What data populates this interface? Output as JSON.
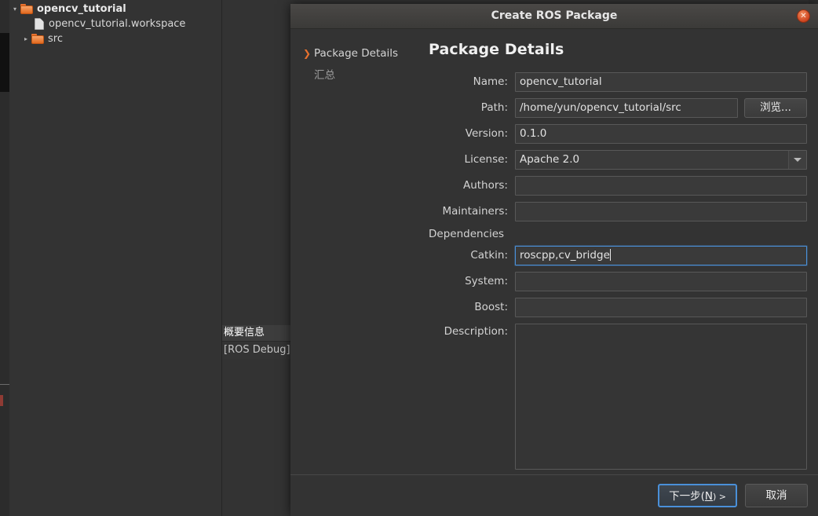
{
  "ide": {
    "tree": [
      {
        "twisty": "▾",
        "indent": 0,
        "icon": "folder-icon",
        "label": "opencv_tutorial",
        "bold": true
      },
      {
        "twisty": "",
        "indent": 1,
        "icon": "file-icon",
        "label": "opencv_tutorial.workspace",
        "bold": false
      },
      {
        "twisty": "▸",
        "indent": 1,
        "icon": "folder-icon",
        "label": "src",
        "bold": false
      }
    ],
    "summary_popup": {
      "header": "概要信息",
      "body": "[ROS Debug]"
    }
  },
  "dialog": {
    "title": "Create ROS Package",
    "close_label": "✕",
    "nav": [
      {
        "label": "Package Details",
        "arrow": "❯",
        "active": true
      },
      {
        "label": "汇总",
        "arrow": "❯",
        "active": false
      }
    ],
    "heading": "Package Details",
    "fields": {
      "name_label": "Name:",
      "name_value": "opencv_tutorial",
      "path_label": "Path:",
      "path_value": "/home/yun/opencv_tutorial/src",
      "browse_label": "浏览...",
      "version_label": "Version:",
      "version_value": "0.1.0",
      "license_label": "License:",
      "license_value": "Apache 2.0",
      "authors_label": "Authors:",
      "authors_value": "",
      "maintainers_label": "Maintainers:",
      "maintainers_value": "",
      "dependencies_label": "Dependencies",
      "catkin_label": "Catkin:",
      "catkin_value": "roscpp,cv_bridge",
      "system_label": "System:",
      "system_value": "",
      "boost_label": "Boost:",
      "boost_value": "",
      "description_label": "Description:",
      "description_value": ""
    },
    "buttons": {
      "next_prefix": "下一步(",
      "next_mnemonic": "N",
      "next_suffix": ") >",
      "cancel_label": "取消"
    }
  },
  "colors": {
    "accent_orange": "#e8712e",
    "focus_blue": "#4a90d9",
    "dialog_bg": "#333333",
    "titlebar": "#45433f"
  }
}
